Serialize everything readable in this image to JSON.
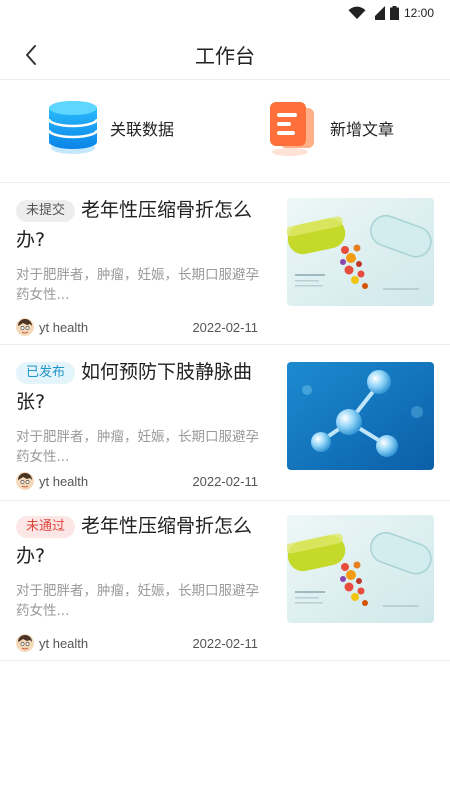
{
  "status_bar": {
    "time": "12:00"
  },
  "nav": {
    "title": "工作台"
  },
  "actions": [
    {
      "label": "关联数据",
      "icon": "database-icon",
      "color": "#1a9ff0"
    },
    {
      "label": "新增文章",
      "icon": "document-icon",
      "color": "#ff6f3c"
    }
  ],
  "articles": [
    {
      "status": "未提交",
      "title": "老年性压缩骨折怎么办?",
      "summary": "对于肥胖者，肿瘤，妊娠，长期口服避孕药女性...",
      "author": "yt health",
      "date": "2022-02-11",
      "thumb": "medical-capsule-image"
    },
    {
      "status": "已发布",
      "title": "如何预防下肢静脉曲张?",
      "summary": "对于肥胖者，肿瘤，妊娠，长期口服避孕药女性...",
      "author": "yt health",
      "date": "2022-02-11",
      "thumb": "molecule-image"
    },
    {
      "status": "未通过",
      "title": "老年性压缩骨折怎么办?",
      "summary": "对于肥胖者，肿瘤，妊娠，长期口服避孕药女性...",
      "author": "yt health",
      "date": "2022-02-11",
      "thumb": "medical-capsule-image"
    }
  ],
  "colors": {
    "badge_draft": "#555555",
    "badge_published": "#2196c9",
    "badge_rejected": "#e0463c"
  }
}
